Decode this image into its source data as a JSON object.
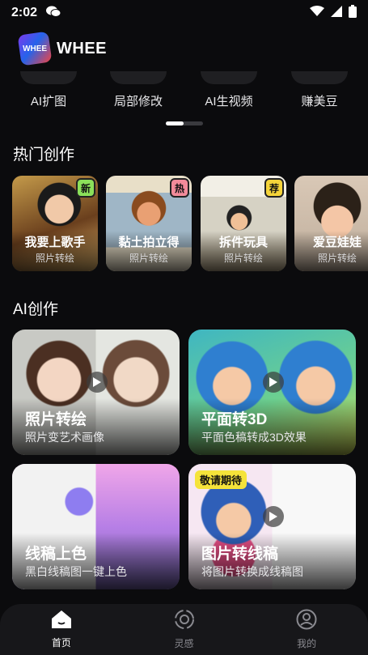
{
  "status": {
    "time": "2:02"
  },
  "app": {
    "title": "WHEE",
    "logo_text": "WHEE"
  },
  "tools": [
    {
      "label": "AI扩图"
    },
    {
      "label": "局部修改"
    },
    {
      "label": "AI生视频"
    },
    {
      "label": "赚美豆"
    }
  ],
  "hot": {
    "title": "热门创作",
    "items": [
      {
        "name": "我要上歌手",
        "sub": "照片转绘",
        "badge": "新",
        "badge_color": "#8be05a"
      },
      {
        "name": "黏土拍立得",
        "sub": "照片转绘",
        "badge": "热",
        "badge_color": "#f28b9a"
      },
      {
        "name": "拆件玩具",
        "sub": "照片转绘",
        "badge": "荐",
        "badge_color": "#f5d43a"
      },
      {
        "name": "爱豆娃娃",
        "sub": "照片转绘",
        "badge": "",
        "badge_color": ""
      }
    ]
  },
  "ai": {
    "title": "AI创作",
    "items": [
      {
        "title": "照片转绘",
        "sub": "照片变艺术画像",
        "badge": ""
      },
      {
        "title": "平面转3D",
        "sub": "平面色稿转成3D效果",
        "badge": ""
      },
      {
        "title": "线稿上色",
        "sub": "黑白线稿图一键上色",
        "badge": ""
      },
      {
        "title": "图片转线稿",
        "sub": "将图片转换成线稿图",
        "badge": "敬请期待"
      }
    ]
  },
  "nav": [
    {
      "label": "首页",
      "icon": "home-icon",
      "active": true
    },
    {
      "label": "灵感",
      "icon": "inspiration-icon",
      "active": false
    },
    {
      "label": "我的",
      "icon": "profile-icon",
      "active": false
    }
  ]
}
